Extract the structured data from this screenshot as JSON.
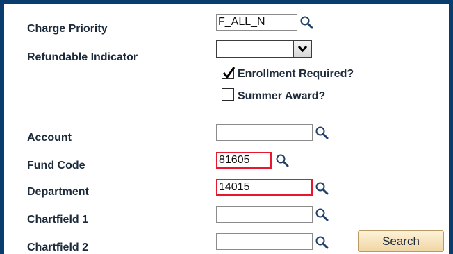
{
  "form": {
    "charge_priority": {
      "label": "Charge Priority",
      "value": "F_ALL_N"
    },
    "refundable_indicator": {
      "label": "Refundable Indicator",
      "value": ""
    },
    "enrollment_required": {
      "label": "Enrollment Required?",
      "checked": true
    },
    "summer_award": {
      "label": "Summer Award?",
      "checked": false
    },
    "account": {
      "label": "Account",
      "value": ""
    },
    "fund_code": {
      "label": "Fund Code",
      "value": "81605"
    },
    "department": {
      "label": "Department",
      "value": "14015"
    },
    "chartfield1": {
      "label": "Chartfield 1",
      "value": ""
    },
    "chartfield2": {
      "label": "Chartfield 2",
      "value": ""
    },
    "search_button": {
      "label": "Search"
    }
  },
  "icons": {
    "lookup": "magnifying-glass-icon",
    "dropdown": "chevron-down-icon",
    "check": "checkmark-icon"
  },
  "colors": {
    "frame": "#0b3c6e",
    "highlight": "#e8172d",
    "label": "#1c2a3a",
    "button_top": "#fdf1d8",
    "button_bottom": "#f0d6a4"
  }
}
